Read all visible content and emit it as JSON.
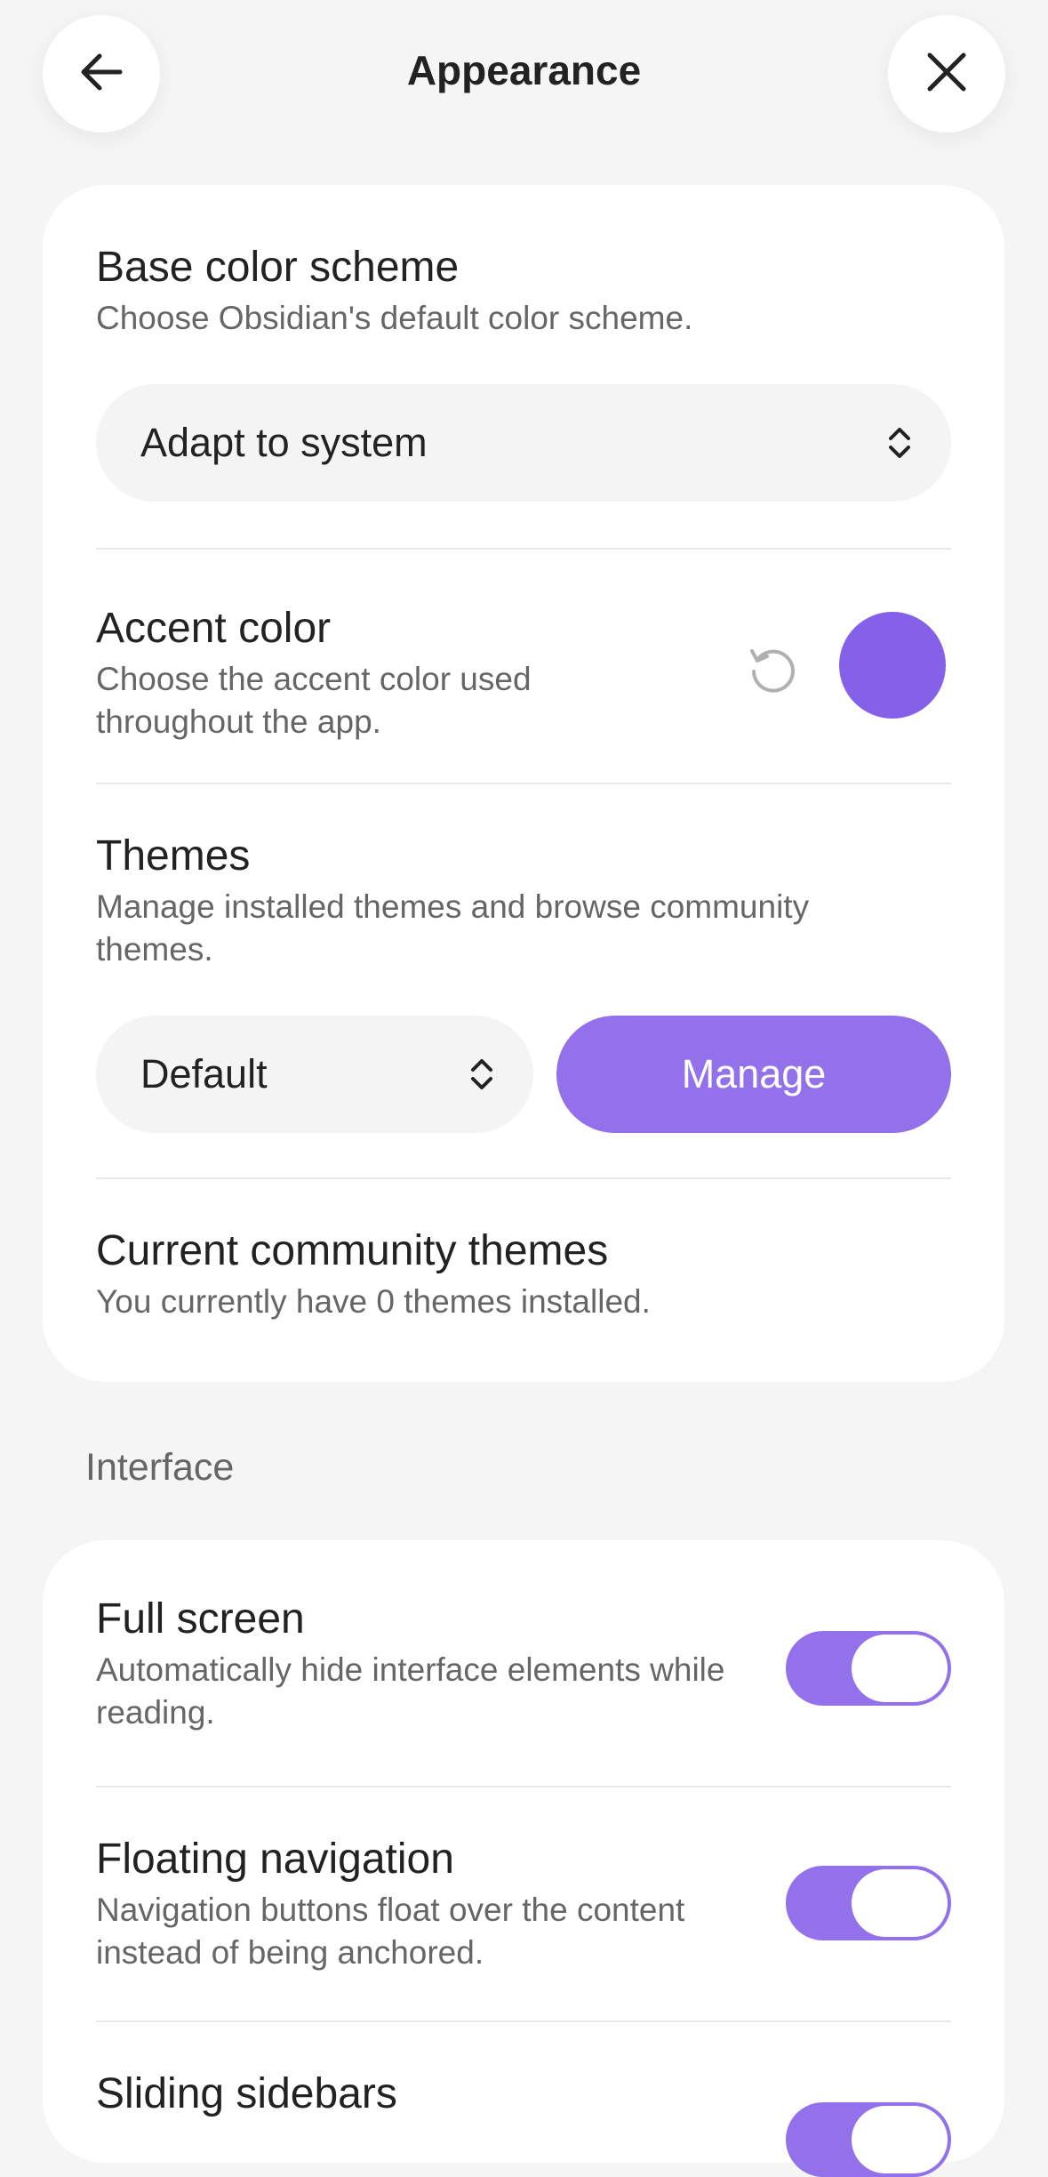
{
  "header": {
    "title": "Appearance",
    "back_icon": "arrow-left-icon",
    "close_icon": "close-icon"
  },
  "appearance": {
    "base_color_scheme": {
      "name": "Base color scheme",
      "desc": "Choose Obsidian's default color scheme.",
      "value": "Adapt to system"
    },
    "accent_color": {
      "name": "Accent color",
      "desc": "Choose the accent color used throughout the app.",
      "color": "#8560e9",
      "reset_icon": "reset-icon"
    },
    "themes": {
      "name": "Themes",
      "desc": "Manage installed themes and browse community themes.",
      "value": "Default",
      "button": "Manage"
    },
    "community_themes": {
      "name": "Current community themes",
      "desc": "You currently have 0 themes installed."
    }
  },
  "interface": {
    "heading": "Interface",
    "items": [
      {
        "name": "Full screen",
        "desc": "Automatically hide interface elements while reading.",
        "enabled": true
      },
      {
        "name": "Floating navigation",
        "desc": "Navigation buttons float over the content instead of being anchored.",
        "enabled": true
      },
      {
        "name": "Sliding sidebars",
        "enabled": true
      }
    ]
  },
  "colors": {
    "accent": "#9271ea",
    "background": "#f5f5f5",
    "card": "#ffffff"
  }
}
